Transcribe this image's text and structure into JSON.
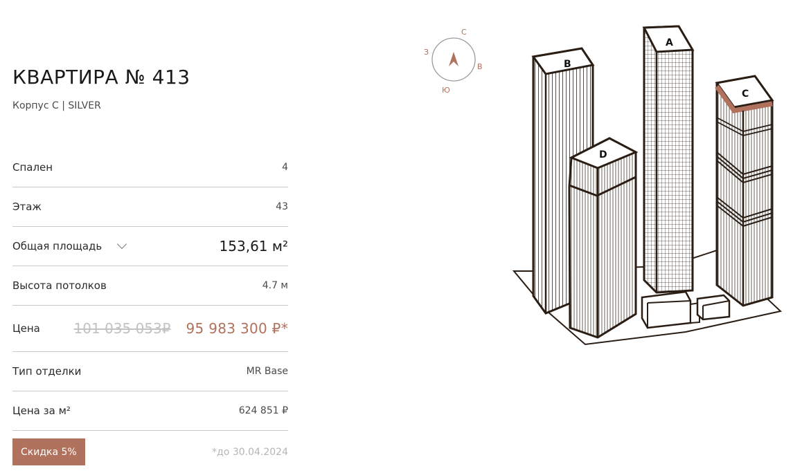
{
  "apartment": {
    "title": "КВАРТИРА № 413",
    "subtitle": "Корпус С | SILVER"
  },
  "details": {
    "bedrooms": {
      "label": "Спален",
      "value": "4"
    },
    "floor": {
      "label": "Этаж",
      "value": "43"
    },
    "area": {
      "label": "Общая площадь",
      "value": "153,61 м²"
    },
    "ceiling": {
      "label": "Высота потолков",
      "value": "4.7 м"
    },
    "price": {
      "label": "Цена",
      "old": "101 035 053₽",
      "new": "95 983 300 ₽*"
    },
    "finish": {
      "label": "Тип отделки",
      "value": "MR Base"
    },
    "price_per_m2": {
      "label": "Цена за м²",
      "value": "624 851 ₽"
    }
  },
  "discount": {
    "button_label": "Скидка 5%",
    "note": "*до 30.04.2024"
  },
  "compass": {
    "north": "С",
    "east": "В",
    "south": "Ю",
    "west": "З"
  },
  "towers": {
    "a": "A",
    "b": "B",
    "c": "C",
    "d": "D"
  },
  "colors": {
    "accent": "#b0715d",
    "outline": "#2a1d14",
    "divider": "#c9c9c9"
  },
  "icons": {
    "area_toggle": "chevron-down-icon",
    "compass_needle": "compass-arrow-icon"
  }
}
